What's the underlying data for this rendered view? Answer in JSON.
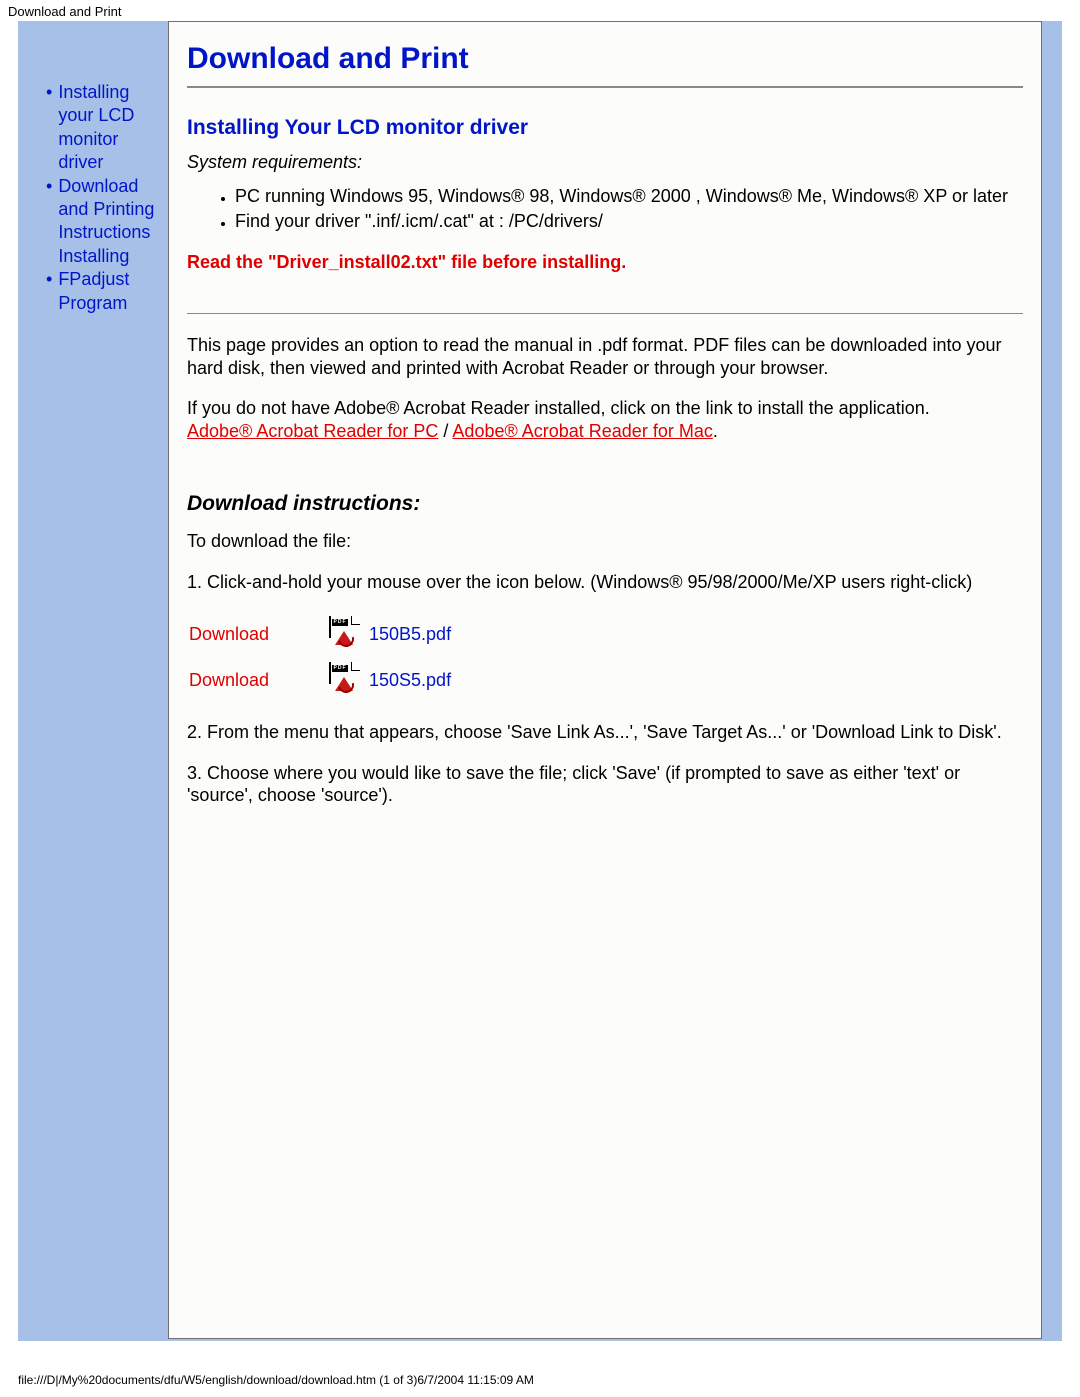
{
  "header_title": "Download and Print",
  "sidebar": {
    "items": [
      {
        "label": "Installing your LCD monitor driver"
      },
      {
        "label": "Download and Printing Instructions Installing"
      },
      {
        "label": "FPadjust Program"
      }
    ]
  },
  "main": {
    "title": "Download and Print",
    "section1_heading": "Installing Your LCD monitor driver",
    "sysreq_label": "System requirements:",
    "sysreq_items": [
      "PC running Windows 95, Windows® 98, Windows® 2000 , Windows® Me, Windows® XP or later",
      "Find your driver \".inf/.icm/.cat\" at : /PC/drivers/"
    ],
    "read_warning": "Read the \"Driver_install02.txt\" file before installing.",
    "para1": "This page provides an option to read the manual in .pdf format. PDF files can be downloaded into your hard disk, then viewed and printed with Acrobat Reader or through your browser.",
    "para2_pre": "If you do not have Adobe® Acrobat Reader installed, click on the link to install the application. ",
    "acrobat_pc_label": "Adobe® Acrobat Reader for PC",
    "acrobat_sep": " / ",
    "acrobat_mac_label": "Adobe® Acrobat Reader for Mac",
    "para2_post": ".",
    "dl_heading": "Download instructions:",
    "dl_intro": "To download the file:",
    "step1": "1. Click-and-hold your mouse over the icon below. (Windows® 95/98/2000/Me/XP users right-click)",
    "downloads": [
      {
        "label": "Download",
        "filename": "150B5.pdf"
      },
      {
        "label": "Download",
        "filename": "150S5.pdf"
      }
    ],
    "step2": "2. From the menu that appears, choose 'Save Link As...', 'Save Target As...' or 'Download Link to Disk'.",
    "step3": "3. Choose where you would like to save the file; click 'Save' (if prompted to save as either 'text' or 'source', choose 'source')."
  },
  "footer": "file:///D|/My%20documents/dfu/W5/english/download/download.htm (1 of 3)6/7/2004 11:15:09 AM"
}
